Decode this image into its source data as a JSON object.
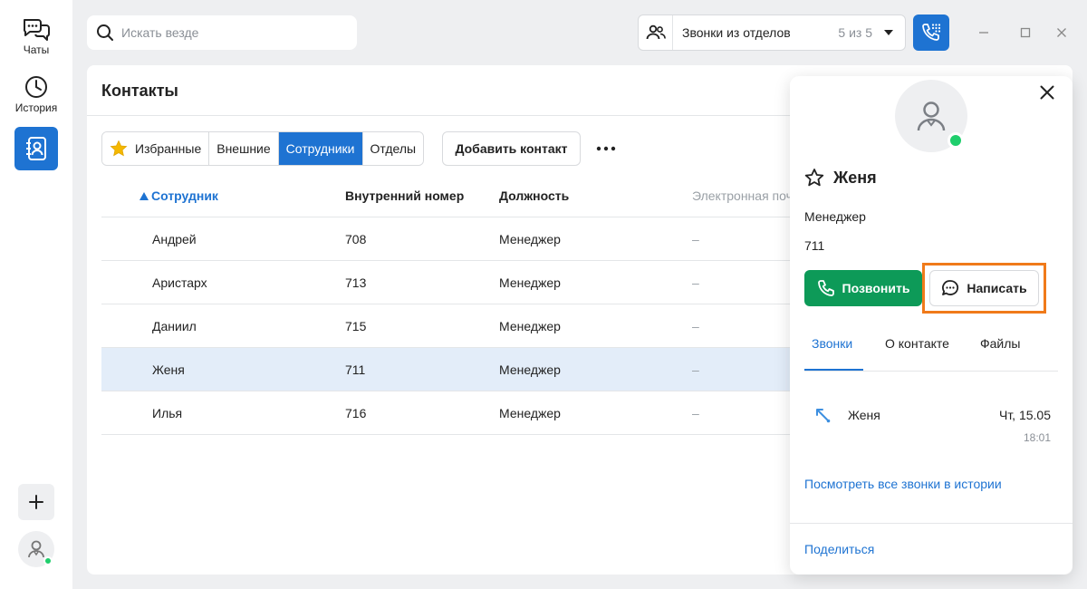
{
  "rail": {
    "items": [
      {
        "label": "Чаты",
        "icon": "chat-icon"
      },
      {
        "label": "История",
        "icon": "clock-icon"
      },
      {
        "label": "",
        "icon": "contacts-book-icon"
      }
    ]
  },
  "search": {
    "placeholder": "Искать везде"
  },
  "department": {
    "title": "Звонки из отделов",
    "count": "5 из 5"
  },
  "main": {
    "title": "Контакты",
    "filters": [
      "Избранные",
      "Внешние",
      "Сотрудники",
      "Отделы"
    ],
    "active_filter": "Сотрудники",
    "add_contact": "Добавить контакт"
  },
  "table": {
    "columns": [
      "Сотрудник",
      "Внутренний номер",
      "Должность",
      "Электронная поч"
    ],
    "rows": [
      {
        "name": "Андрей",
        "ext": "708",
        "role": "Менеджер",
        "email": "–"
      },
      {
        "name": "Аристарх",
        "ext": "713",
        "role": "Менеджер",
        "email": "–"
      },
      {
        "name": "Даниил",
        "ext": "715",
        "role": "Менеджер",
        "email": "–"
      },
      {
        "name": "Женя",
        "ext": "711",
        "role": "Менеджер",
        "email": "–"
      },
      {
        "name": "Илья",
        "ext": "716",
        "role": "Менеджер",
        "email": "–"
      }
    ],
    "selected_row": 3
  },
  "card": {
    "name": "Женя",
    "role": "Менеджер",
    "ext": "711",
    "call_label": "Позвонить",
    "write_label": "Написать",
    "tabs": [
      "Звонки",
      "О контакте",
      "Файлы"
    ],
    "active_tab": "Звонки",
    "last_call": {
      "name": "Женя",
      "date": "Чт, 15.05",
      "time": "18:01"
    },
    "all_calls_link": "Посмотреть все звонки в истории",
    "share_label": "Поделиться"
  },
  "colors": {
    "accent": "#1e73d2",
    "call_green": "#0d9a58",
    "online": "#1fce6c",
    "highlight": "#f07a1a",
    "selected_row": "#e3edf9"
  }
}
